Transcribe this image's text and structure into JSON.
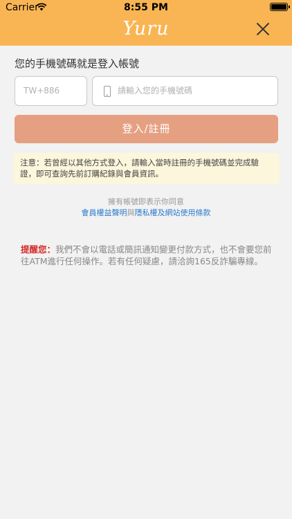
{
  "status_bar": {
    "carrier": "Carrier",
    "time": "8:55 PM"
  },
  "header": {
    "logo": "Yuru",
    "close_icon": "close-icon"
  },
  "form": {
    "title": "您的手機號碼就是登入帳號",
    "country_code_placeholder": "TW+886",
    "phone_placeholder": "請輸入您的手機號碼",
    "submit_label": "登入/註冊"
  },
  "notice": {
    "text": "注意：若曾經以其他方式登入，請輸入當時註冊的手機號碼並完成驗證，即可查詢先前訂購紀錄與會員資訊。"
  },
  "terms": {
    "agree_text": "擁有帳號即表示你同意",
    "link1": "會員權益聲明",
    "connector": "與",
    "link2": "隱私權及網站使用條款"
  },
  "reminder": {
    "label": "提醒您：",
    "text": "我們不會以電話或簡訊通知變更付款方式，也不會要您前往ATM進行任何操作。若有任何疑慮，請洽詢165反詐騙專線。"
  },
  "colors": {
    "header": "#f9b553",
    "button": "#e5a082",
    "notice_bg": "#fcf6dc",
    "link": "#2e7bcf",
    "alert": "#d62a2a"
  }
}
